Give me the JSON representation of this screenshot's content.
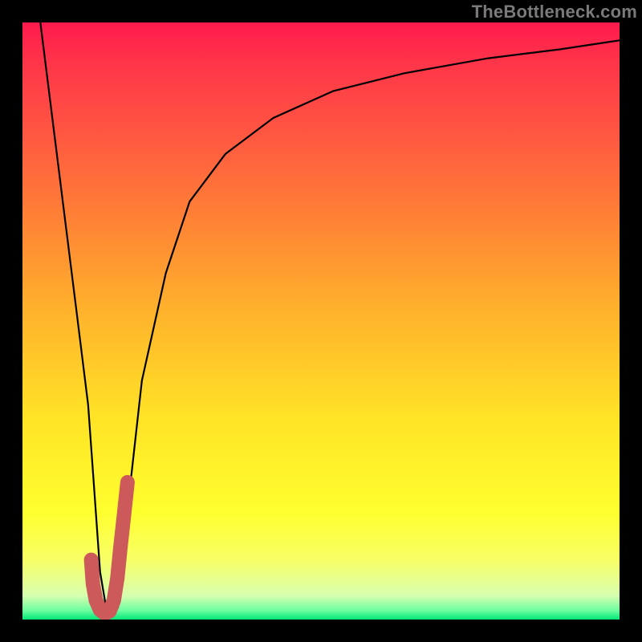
{
  "watermark": "TheBottleneck.com",
  "chart_data": {
    "type": "line",
    "title": "",
    "xlabel": "",
    "ylabel": "",
    "xlim": [
      0,
      100
    ],
    "ylim": [
      0,
      100
    ],
    "grid": false,
    "legend": false,
    "series": [
      {
        "name": "bottleneck-curve",
        "color": "#000000",
        "x": [
          3,
          5,
          7,
          9,
          10,
          11,
          12,
          13,
          14,
          15,
          16,
          17,
          18,
          20,
          24,
          28,
          34,
          42,
          52,
          64,
          78,
          90,
          100
        ],
        "y": [
          100,
          84,
          68,
          52,
          44,
          36,
          22,
          8,
          2,
          0.5,
          2,
          10,
          22,
          40,
          58,
          70,
          78,
          84,
          88.5,
          91.5,
          94,
          95.5,
          97
        ]
      },
      {
        "name": "highlight-hook",
        "color": "#cc5a5a",
        "x": [
          11.5,
          11.8,
          12.3,
          13.0,
          13.8,
          14.6,
          15.3,
          15.9,
          16.4,
          17.0,
          17.6
        ],
        "y": [
          10,
          6,
          3.2,
          1.6,
          1.0,
          1.4,
          3.2,
          7.0,
          12.0,
          17.5,
          23.0
        ]
      }
    ],
    "background_gradient": {
      "top": "#ff1a4d",
      "mid": "#ffe326",
      "bottom": "#00e676"
    }
  }
}
